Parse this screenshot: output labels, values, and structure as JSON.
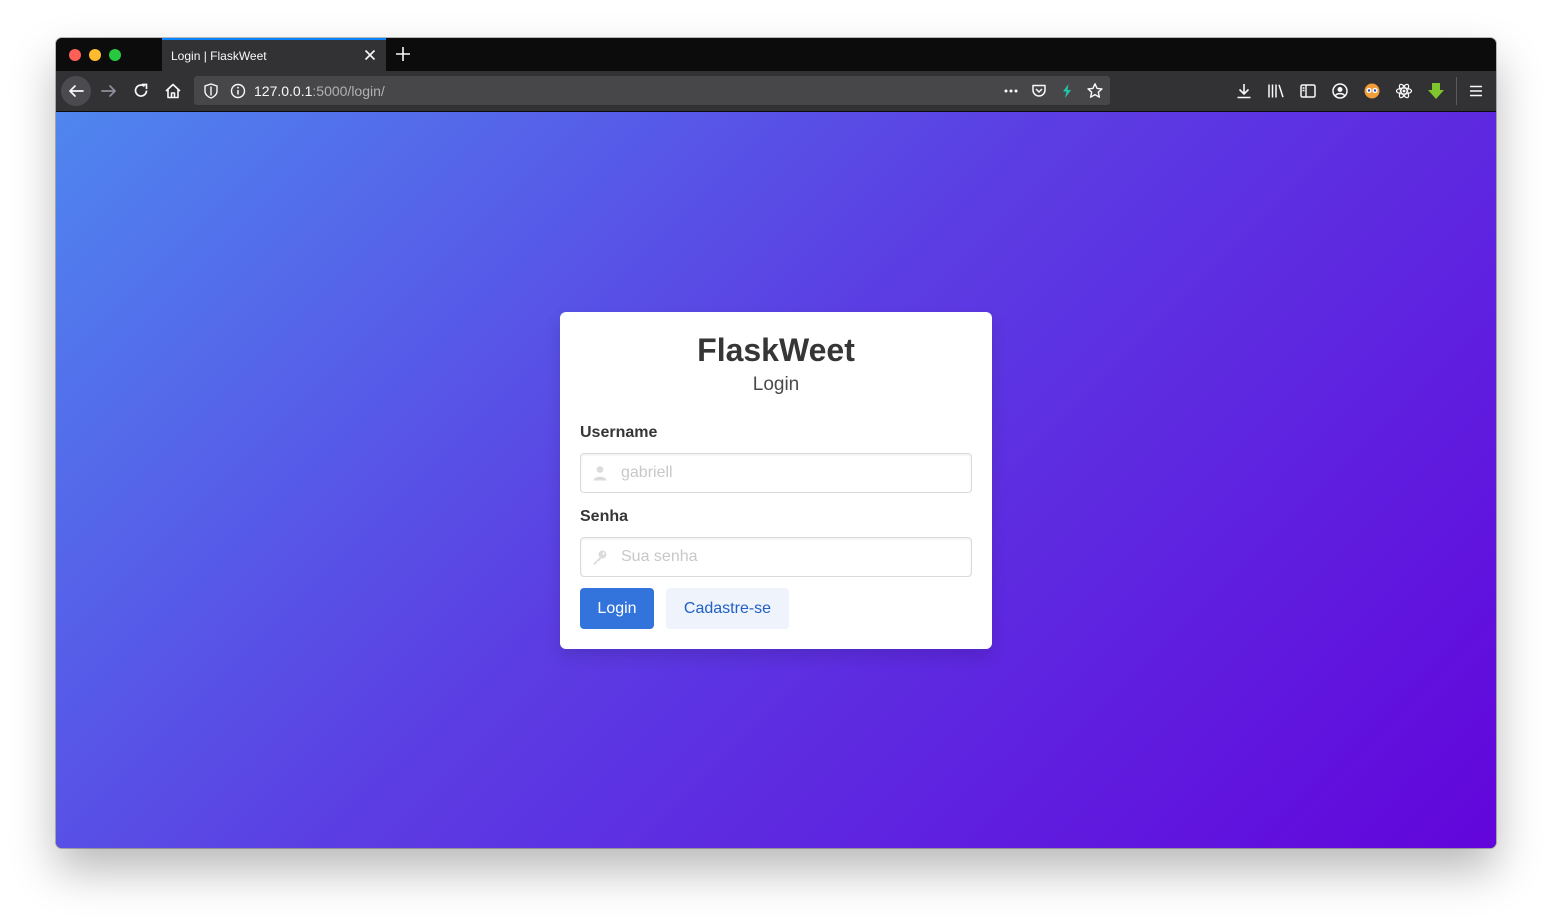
{
  "browser": {
    "tab": {
      "title": "Login | FlaskWeet"
    },
    "url": {
      "host": "127.0.0.1",
      "rest": ":5000/login/"
    }
  },
  "page": {
    "title": "FlaskWeet",
    "subtitle": "Login",
    "username": {
      "label": "Username",
      "placeholder": "gabriell"
    },
    "password": {
      "label": "Senha",
      "placeholder": "Sua senha"
    },
    "buttons": {
      "login": "Login",
      "register": "Cadastre-se"
    }
  },
  "colors": {
    "gradient_start": "#4f86ef",
    "gradient_end": "#6205dc",
    "primary": "#3273dc",
    "link_light": "#eef3fc"
  }
}
